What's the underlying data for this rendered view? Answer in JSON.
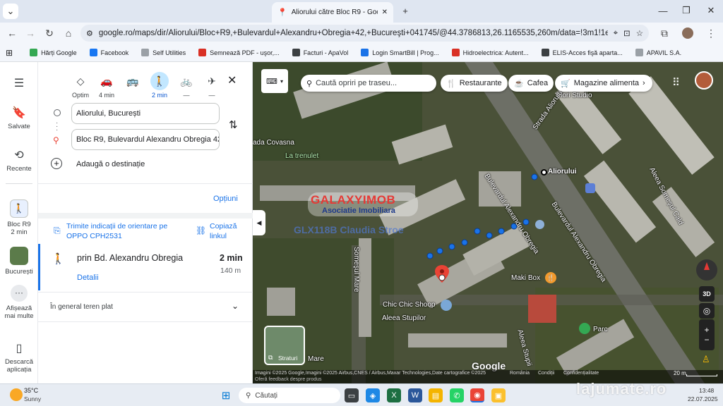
{
  "browser": {
    "tab_title": "Aliorului către Bloc R9 - Google M",
    "url": "google.ro/maps/dir/Aliorului/Bloc+R9,+Bulevardul+Alexandru+Obregia+42,+Bucureşti+041745/@44.3786813,26.1165535,260m/data=!3m1!1e3!4m...",
    "new_tab": "+",
    "close_tab": "✕",
    "bookmarks": [
      {
        "label": "Hărți Google",
        "color": "#34a853"
      },
      {
        "label": "Facebook",
        "color": "#1877f2"
      },
      {
        "label": "Self Utilities",
        "color": "#9aa0a6"
      },
      {
        "label": "Semnează PDF - uşor,...",
        "color": "#d93025"
      },
      {
        "label": "Facturi - ApaVol",
        "color": "#3c4043"
      },
      {
        "label": "Login SmartBill | Prog...",
        "color": "#1a73e8"
      },
      {
        "label": "Hidroelectrica: Autent...",
        "color": "#d93025"
      },
      {
        "label": "ELIS-Acces fişă aparta...",
        "color": "#3c4043"
      },
      {
        "label": "APAVIL S.A.",
        "color": "#9aa0a6"
      }
    ]
  },
  "rail": {
    "saved": "Salvate",
    "recent": "Recente",
    "recent_item_1_line1": "Bloc R9",
    "recent_item_1_line2": "2 min",
    "recent_item_2": "București",
    "more_line1": "Afișează",
    "more_line2": "mai multe",
    "download_line1": "Descarcă",
    "download_line2": "aplicația"
  },
  "panel": {
    "modes": [
      {
        "label": "Optim",
        "icon": "◇"
      },
      {
        "label": "4 min",
        "icon": "🚗"
      },
      {
        "label": "",
        "icon": "🚌"
      },
      {
        "label": "2 min",
        "icon": "🚶"
      },
      {
        "label": "—",
        "icon": "🚲"
      },
      {
        "label": "—",
        "icon": "✈"
      }
    ],
    "origin": "Aliorului, București",
    "destination": "Bloc R9, Bulevardul Alexandru Obregia 42",
    "add_destination": "Adaugă o destinație",
    "options": "Opțiuni",
    "send_line1": "Trimite indicații de orientare pe",
    "send_line2": "OPPO CPH2531",
    "copy_line1": "Copiază",
    "copy_line2": "linkul",
    "route_name": "prin Bd. Alexandru Obregia",
    "route_time": "2 min",
    "route_distance": "140 m",
    "details": "Detalii",
    "terrain": "În general teren plat"
  },
  "map": {
    "search_placeholder": "Caută opriri pe traseu...",
    "chips": [
      "Restaurante",
      "Cafea",
      "Magazine alimenta"
    ],
    "labels": {
      "flori": "Flori Studio",
      "strada_aliorului": "Strada Aliorului",
      "covasna": "ada Covasna",
      "la_trenulet": "La trenulet",
      "aliorului_point": "Aliorului",
      "bd1": "Bulevardul Alexandru Obregia",
      "bd2": "Bulevardul Alexandru Obregia",
      "aleea_somesul_cald": "Aleea Someşul Cald",
      "somesul_mare": "Someşul Mare",
      "maki_box": "Maki Box",
      "chic": "Chic Chic Shoop",
      "aleea_stupilor": "Aleea Stupilor",
      "aleea_stupii": "Aleea Stupii",
      "parc": "Parc",
      "mare": "Mare"
    },
    "watermark_top": "GALAXYIMOB",
    "watermark_sub": "Asociatie Imobiliara",
    "watermark_code": "GLX118B Claudia Stroe",
    "layers": "Straturi",
    "google": "Google",
    "footer": "Imagini ©2025 Google,Imagini ©2025 Airbus,CNES / Airbus,Maxar Technologies,Date cartografice ©2025",
    "footer_links": [
      "România",
      "Condiții",
      "Confidențialitate"
    ],
    "footer2": "Oferă feedback despre produs",
    "scale": "20 m",
    "btn_3d": "3D"
  },
  "taskbar": {
    "temp": "35°C",
    "weather": "Sunny",
    "search": "Căutați",
    "time": "13:48",
    "date": "22.07.2025",
    "site_watermark": "lajumate.ro"
  }
}
